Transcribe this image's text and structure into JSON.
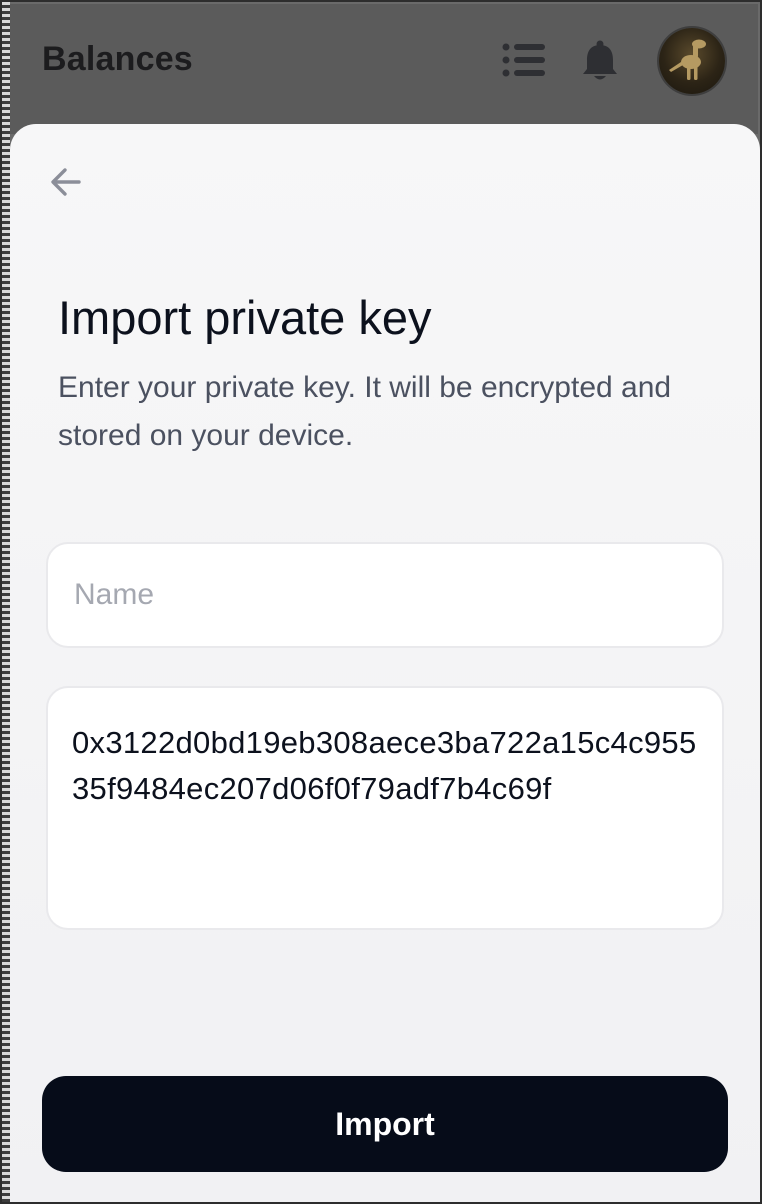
{
  "header": {
    "title": "Balances",
    "icons": [
      "list-icon",
      "bell-icon",
      "avatar"
    ]
  },
  "sheet": {
    "back_icon": "arrow-left-icon",
    "heading": "Import private key",
    "subtitle": "Enter your private key. It will be encrypted and stored on your device.",
    "name_field": {
      "value": "",
      "placeholder": "Name"
    },
    "private_key_field": {
      "value": "0x3122d0bd19eb308aece3ba722a15c4c95535f9484ec207d06f0f79adf7b4c69f"
    },
    "import_label": "Import"
  },
  "colors": {
    "primary_button": "#060c19",
    "sheet_background": "#f4f4f6",
    "heading_text": "#0c111d",
    "subtitle_text": "#4b5160",
    "placeholder_text": "#a5a8b1"
  }
}
